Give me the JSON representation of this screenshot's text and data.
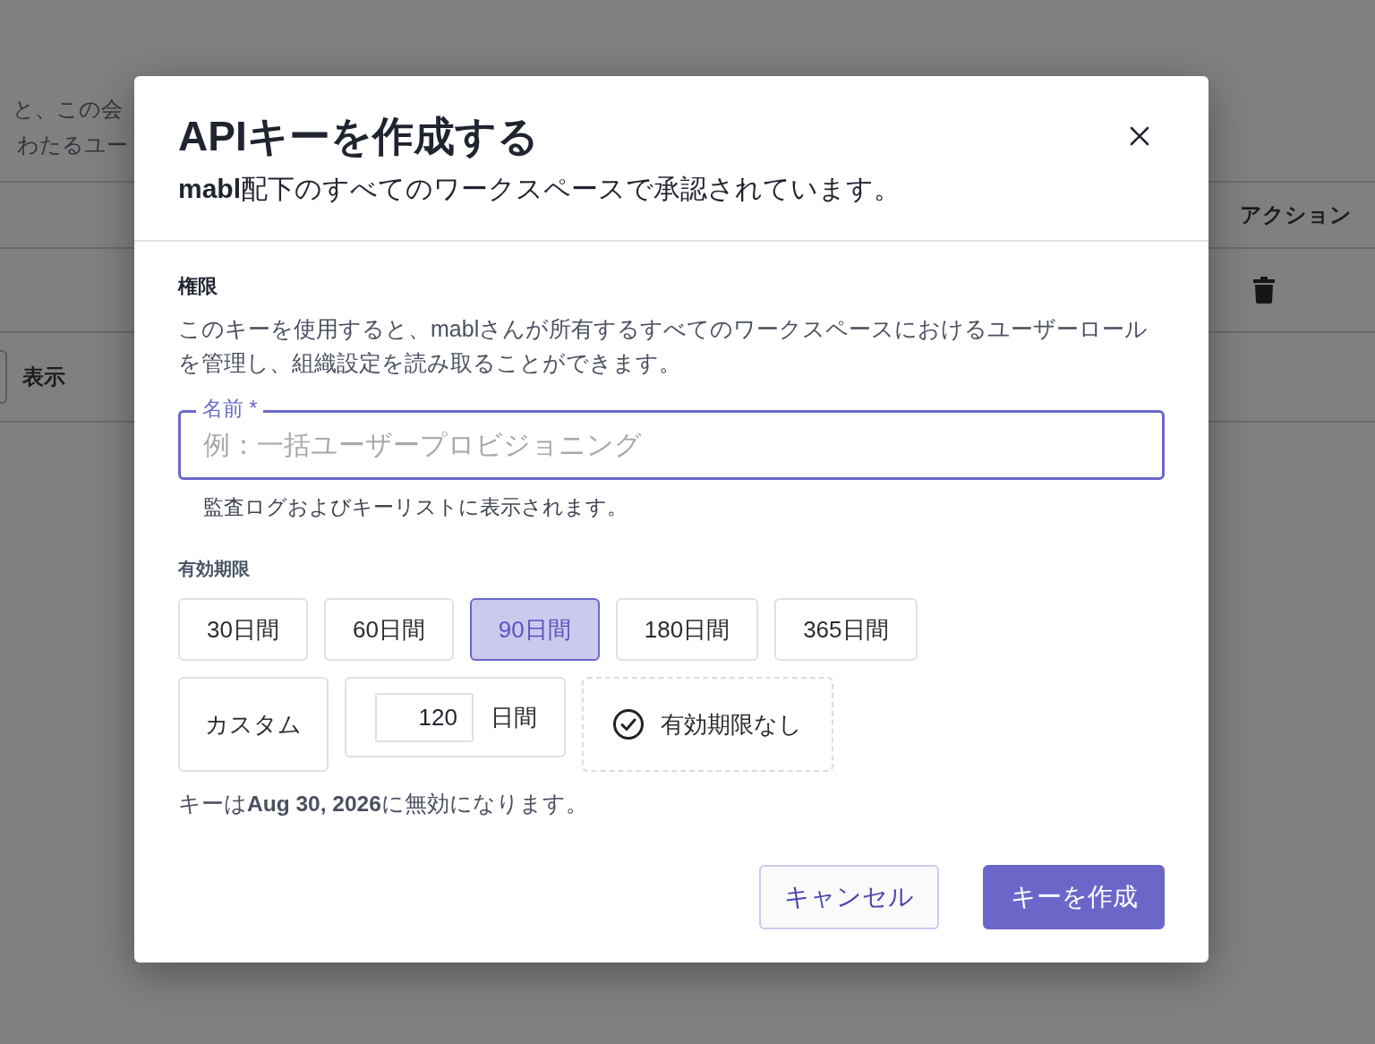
{
  "background_page": {
    "intro_lines": [
      "と、この会",
      "わたるユー"
    ],
    "table": {
      "columns": [
        {
          "label": "アクション"
        }
      ],
      "rows": [
        {
          "kind": "delete_action"
        },
        {
          "kind": "toggle",
          "label": "表示"
        }
      ]
    }
  },
  "dialog": {
    "title": "APIキーを作成する",
    "subtitle": "**mabl**配下のすべてのワークスペースで承認されています。",
    "permissions": {
      "heading": "権限",
      "description": "このキーを使用すると、mablさんが所有するすべてのワークスペースにおけるユーザーロールを管理し、組織設定を読み取ることができます。"
    },
    "name_field": {
      "label": "名前 *",
      "placeholder": "例：一括ユーザープロビジョニング",
      "helper": "監査ログおよびキーリストに表示されます。"
    },
    "expiration": {
      "heading": "有効期限",
      "presets": [
        {
          "label": "30日間",
          "selected": false
        },
        {
          "label": "60日間",
          "selected": false
        },
        {
          "label": "90日間",
          "selected": true
        },
        {
          "label": "180日間",
          "selected": false
        },
        {
          "label": "365日間",
          "selected": false
        }
      ],
      "custom": {
        "label": "カスタム",
        "selected": false,
        "value": "120",
        "unit": "日間"
      },
      "no_expiry": {
        "label": "有効期限なし",
        "selected": false
      },
      "note": "キーは**Aug 30, 2026**に無効になります。"
    },
    "buttons": [
      {
        "label": "キャンセル",
        "kind": "secondary"
      },
      {
        "label": "キーを作成",
        "kind": "primary"
      }
    ]
  }
}
